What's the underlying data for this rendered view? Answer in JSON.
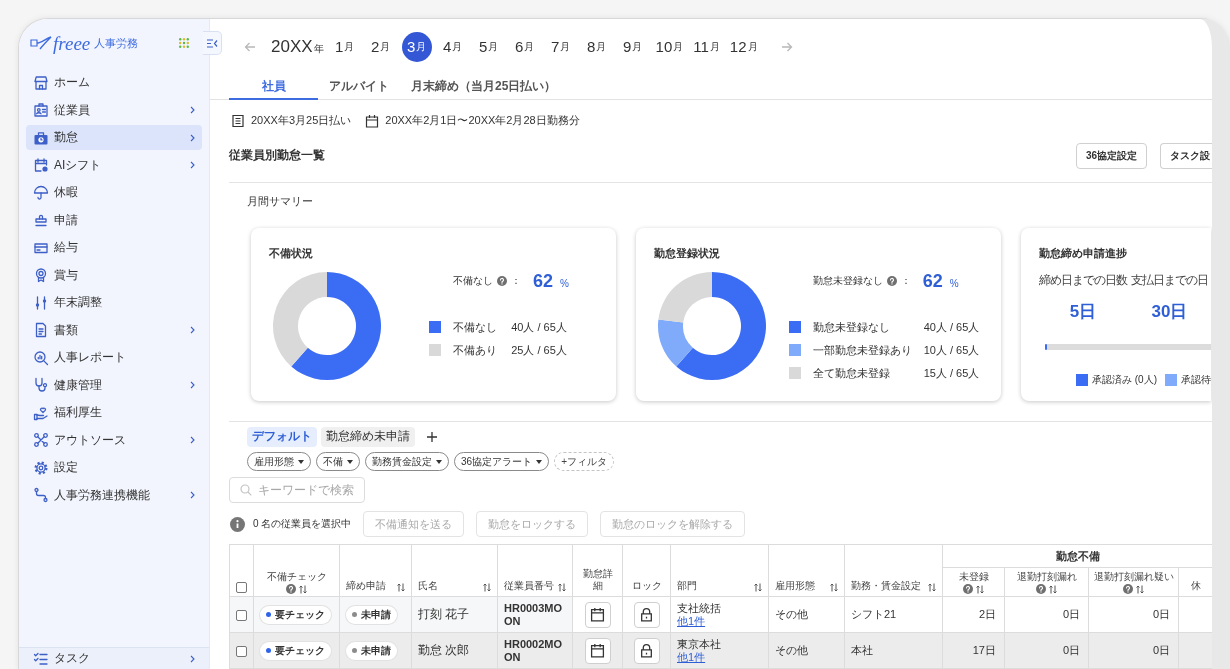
{
  "sidebar": {
    "logo": {
      "wordmark": "freee",
      "product": "人事労務"
    },
    "items": [
      {
        "label": "ホーム",
        "has_submenu": false,
        "selected": false
      },
      {
        "label": "従業員",
        "has_submenu": true,
        "selected": false
      },
      {
        "label": "勤怠",
        "has_submenu": true,
        "selected": true
      },
      {
        "label": "AIシフト",
        "has_submenu": true,
        "selected": false
      },
      {
        "label": "休暇",
        "has_submenu": false,
        "selected": false
      },
      {
        "label": "申請",
        "has_submenu": false,
        "selected": false
      },
      {
        "label": "給与",
        "has_submenu": false,
        "selected": false
      },
      {
        "label": "賞与",
        "has_submenu": false,
        "selected": false
      },
      {
        "label": "年末調整",
        "has_submenu": false,
        "selected": false
      },
      {
        "label": "書類",
        "has_submenu": true,
        "selected": false
      },
      {
        "label": "人事レポート",
        "has_submenu": false,
        "selected": false
      },
      {
        "label": "健康管理",
        "has_submenu": true,
        "selected": false
      },
      {
        "label": "福利厚生",
        "has_submenu": false,
        "selected": false
      },
      {
        "label": "アウトソース",
        "has_submenu": true,
        "selected": false
      },
      {
        "label": "設定",
        "has_submenu": false,
        "selected": false
      },
      {
        "label": "人事労務連携機能",
        "has_submenu": true,
        "selected": false
      }
    ],
    "footer_item": {
      "label": "タスク",
      "has_submenu": true
    }
  },
  "month_nav": {
    "year": {
      "value": "20XX",
      "unit": "年"
    },
    "months": [
      {
        "number": "1",
        "unit": "月",
        "selected": false
      },
      {
        "number": "2",
        "unit": "月",
        "selected": false
      },
      {
        "number": "3",
        "unit": "月",
        "selected": true
      },
      {
        "number": "4",
        "unit": "月",
        "selected": false
      },
      {
        "number": "5",
        "unit": "月",
        "selected": false
      },
      {
        "number": "6",
        "unit": "月",
        "selected": false
      },
      {
        "number": "7",
        "unit": "月",
        "selected": false
      },
      {
        "number": "8",
        "unit": "月",
        "selected": false
      },
      {
        "number": "9",
        "unit": "月",
        "selected": false
      },
      {
        "number": "10",
        "unit": "月",
        "selected": false
      },
      {
        "number": "11",
        "unit": "月",
        "selected": false
      },
      {
        "number": "12",
        "unit": "月",
        "selected": false
      }
    ]
  },
  "tabs": [
    {
      "label": "社員",
      "selected": true
    },
    {
      "label": "アルバイト",
      "selected": false
    },
    {
      "label": "月末締め（当月25日払い）",
      "selected": false
    }
  ],
  "period": {
    "payment": "20XX年3月25日払い",
    "work_range": "20XX年2月1日〜20XX年2月28日勤務分"
  },
  "section": {
    "title": "従業員別勤怠一覧",
    "buttons": [
      "36協定設定",
      "タスク設"
    ]
  },
  "summary": {
    "title": "月間サマリー",
    "cards": [
      {
        "kind": "donut",
        "title": "不備状況",
        "headline": {
          "label": "不備なし",
          "separator": "：",
          "value": "62",
          "unit": "%"
        },
        "chart_data": {
          "type": "donut",
          "categories": [
            "不備なし",
            "不備あり"
          ],
          "values": [
            61.5,
            38.5
          ]
        },
        "legend": [
          {
            "reading": "40人 / 65人",
            "color": "#3b6cf4"
          },
          {
            "reading": "25人 / 65人",
            "color": "#d9d9d9"
          }
        ]
      },
      {
        "kind": "donut",
        "title": "勤怠登録状況",
        "headline": {
          "label": "勤怠未登録なし",
          "separator": "：",
          "value": "62",
          "unit": "%"
        },
        "chart_data": {
          "type": "donut",
          "categories": [
            "勤怠未登録なし",
            "一部勤怠未登録あり",
            "全て勤怠未登録"
          ],
          "values": [
            61.5,
            15.4,
            23.1
          ]
        },
        "legend": [
          {
            "reading": "40人 / 65人",
            "color": "#3b6cf4"
          },
          {
            "reading": "10人 / 65人",
            "color": "#80aafa"
          },
          {
            "reading": "15人 / 65人",
            "color": "#d9d9d9"
          }
        ]
      },
      {
        "kind": "progress",
        "title": "勤怠締め申請進捗",
        "counters": [
          {
            "label": "締め日までの日数",
            "value": "5日"
          },
          {
            "label": "支払日までの日",
            "value": "30日"
          }
        ],
        "progress": {
          "level": 0
        },
        "legend": [
          {
            "label": "承認済み (0人)",
            "color": "#3b6cf4"
          },
          {
            "label": "承認待",
            "color": "#80aafa"
          }
        ]
      }
    ]
  },
  "views": {
    "items": [
      {
        "label": "デフォルト",
        "selected": true
      },
      {
        "label": "勤怠締め未申請",
        "selected": false
      }
    ]
  },
  "filters": {
    "chips": [
      "雇用形態",
      "不備",
      "勤務賃金設定",
      "36協定アラート"
    ],
    "add_label": "+フィルタ"
  },
  "search": {
    "placeholder": "キーワードで検索"
  },
  "selection": {
    "text": "0 名の従業員を選択中",
    "actions": [
      {
        "label": "不備通知を送る",
        "disabled": true
      },
      {
        "label": "勤怠をロックする",
        "disabled": true
      },
      {
        "label": "勤怠のロックを解除する",
        "disabled": true
      }
    ]
  },
  "table": {
    "header_checkbox": {
      "checked": false
    },
    "columns": [
      {
        "label": "不備チェック",
        "help": true,
        "sortable": true
      },
      {
        "label": "締め申請",
        "help": false,
        "sortable": true
      },
      {
        "label": "氏名",
        "help": false,
        "sortable": true
      },
      {
        "label": "従業員番号",
        "help": false,
        "sortable": true
      },
      {
        "label": "勤怠詳細",
        "help": false,
        "sortable": false
      },
      {
        "label": "ロック",
        "help": false,
        "sortable": false
      },
      {
        "label": "部門",
        "help": false,
        "sortable": true
      },
      {
        "label": "雇用形態",
        "help": false,
        "sortable": true
      },
      {
        "label": "勤務・賃金設定",
        "help": false,
        "sortable": true
      }
    ],
    "group": {
      "label": "勤怠不備",
      "columns": [
        {
          "label": "未登録",
          "help": true,
          "sortable": true
        },
        {
          "label": "退勤打刻漏れ",
          "help": true,
          "sortable": true
        },
        {
          "label": "退勤打刻漏れ疑い",
          "help": true,
          "sortable": true
        },
        {
          "label": "休",
          "help": false,
          "sortable": false
        }
      ]
    },
    "rows": [
      {
        "checked": false,
        "highlighted": false,
        "check_status": {
          "label": "要チェック",
          "color": "#2f63e8"
        },
        "closing_status": {
          "label": "未申請",
          "color": "#8c8c8c"
        },
        "name": "打刻 花子",
        "employee_no": "HR0003MOON",
        "department": {
          "name": "支社統括",
          "more": "他1件"
        },
        "employment": "その他",
        "wage_setting": "シフト21",
        "counts": [
          "2日",
          "0日",
          "0日"
        ]
      },
      {
        "checked": false,
        "highlighted": true,
        "check_status": {
          "label": "要チェック",
          "color": "#2f63e8"
        },
        "closing_status": {
          "label": "未申請",
          "color": "#8c8c8c"
        },
        "name": "勤怠 次郎",
        "employee_no": "HR0002MOON",
        "department": {
          "name": "東京本社",
          "more": "他1件"
        },
        "employment": "その他",
        "wage_setting": "本社",
        "counts": [
          "17日",
          "0日",
          "0日"
        ]
      }
    ]
  }
}
